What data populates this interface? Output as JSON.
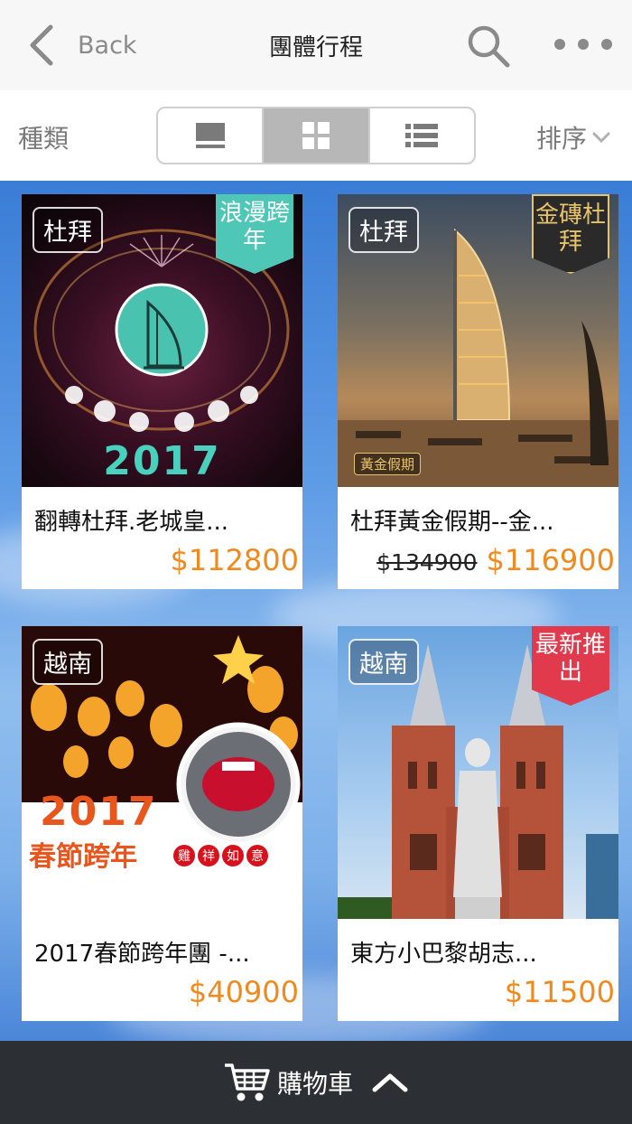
{
  "header": {
    "back_label": "Back",
    "title": "團體行程"
  },
  "filters": {
    "category_label": "種類",
    "sort_label": "排序",
    "views": [
      {
        "name": "single",
        "icon": "single-view-icon",
        "active": false
      },
      {
        "name": "grid",
        "icon": "grid-view-icon",
        "active": true
      },
      {
        "name": "list",
        "icon": "list-view-icon",
        "active": false
      }
    ]
  },
  "products": [
    {
      "tag": "杜拜",
      "ribbon": "浪漫跨年",
      "ribbon_style": "teal",
      "image_text": "2017",
      "name": "翻轉杜拜.老城皇...",
      "old_price": "",
      "price": "$112800"
    },
    {
      "tag": "杜拜",
      "ribbon": "金磚杜拜",
      "ribbon_style": "dark",
      "image_text": "黃金假期",
      "name": "杜拜黃金假期--金...",
      "old_price": "$134900",
      "price": "$116900"
    },
    {
      "tag": "越南",
      "ribbon": "",
      "ribbon_style": "",
      "image_text": "2017",
      "image_subtext": "春節跨年",
      "image_badges": [
        "雞",
        "祥",
        "如",
        "意"
      ],
      "name": "2017春節跨年團 -...",
      "old_price": "",
      "price": "$40900"
    },
    {
      "tag": "越南",
      "ribbon": "最新推出",
      "ribbon_style": "red",
      "image_text": "",
      "name": "東方小巴黎胡志...",
      "old_price": "",
      "price": "$11500"
    }
  ],
  "cart": {
    "label": "購物車"
  },
  "colors": {
    "price": "#f08a1e",
    "cart_bar": "#2c2f33",
    "active_view": "#b7b7b7"
  }
}
